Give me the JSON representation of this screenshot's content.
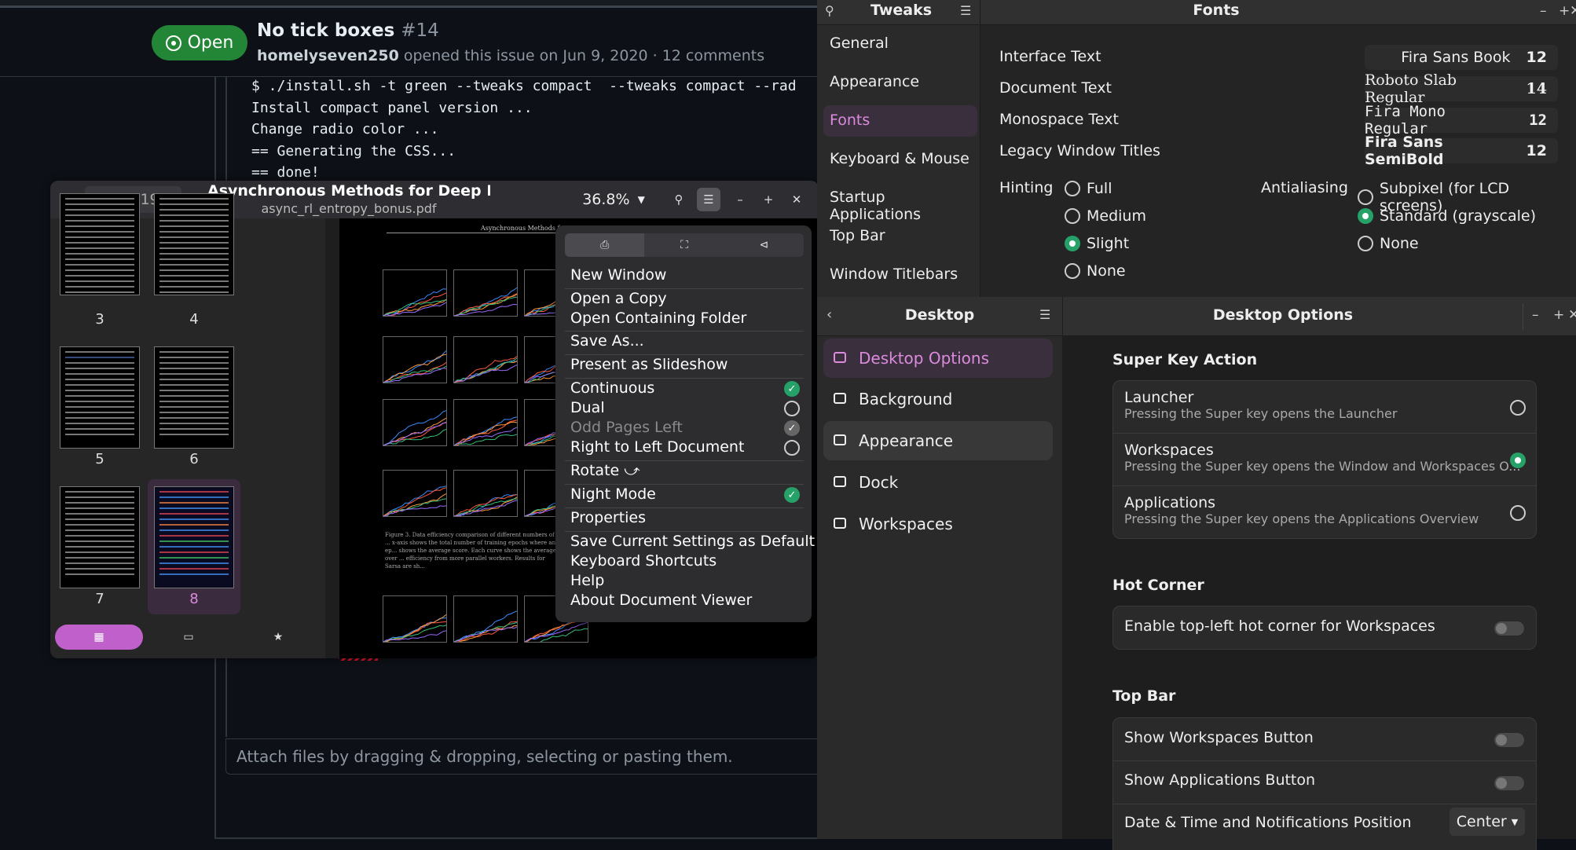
{
  "github": {
    "status_label": "Open",
    "issue_title": "No tick boxes",
    "issue_number": "#14",
    "author": "homelyseven250",
    "meta": "opened this issue on Jun 9, 2020 · 12 comments",
    "code_lines": [
      "$ ./install.sh -t green --tweaks compact  --tweaks compact --rad",
      "Install compact panel version ...",
      "Change radio color ...",
      "== Generating the CSS...",
      "== done!"
    ],
    "attach_placeholder": "Attach files by dragging & dropping, selecting or pasting them."
  },
  "viewer": {
    "current_page": "8",
    "page_total": "of 19",
    "title": "Asynchronous Methods for Deep Reinforcem...",
    "filename": "async_rl_entropy_bonus.pdf",
    "zoom": "36.8%",
    "thumbnails": [
      "3",
      "4",
      "5",
      "6",
      "7",
      "8"
    ],
    "pdf_header": "Asynchronous Methods f",
    "caption": "Figure 3. Data efficiency comparison of different numbers of ... x-axis shows the total number of training epochs where an ep... shows the average score. Each curve shows the average over ... efficiency from more parallel workers. Results for Sarsa are sh...",
    "menu": {
      "new_window": "New Window",
      "open_copy": "Open a Copy",
      "open_folder": "Open Containing Folder",
      "save_as": "Save As...",
      "present": "Present as Slideshow",
      "continuous": "Continuous",
      "dual": "Dual",
      "odd_left": "Odd Pages Left",
      "rtl": "Right to Left Document",
      "rotate": "Rotate",
      "night": "Night Mode",
      "properties": "Properties",
      "save_default": "Save Current Settings as Default",
      "shortcuts": "Keyboard Shortcuts",
      "help": "Help",
      "about": "About Document Viewer"
    }
  },
  "tweaks": {
    "app_title": "Tweaks",
    "page_title": "Fonts",
    "nav": [
      "General",
      "Appearance",
      "Fonts",
      "Keyboard & Mouse",
      "Startup Applications",
      "Top Bar",
      "Window Titlebars"
    ],
    "fonts": [
      {
        "label": "Interface Text",
        "font": "Fira Sans Book",
        "size": "12"
      },
      {
        "label": "Document Text",
        "font": "Roboto Slab Regular",
        "size": "14"
      },
      {
        "label": "Monospace Text",
        "font": "Fira Mono Regular",
        "size": "12"
      },
      {
        "label": "Legacy Window Titles",
        "font": "Fira Sans SemiBold",
        "size": "12"
      }
    ],
    "hinting_label": "Hinting",
    "hinting": [
      "Full",
      "Medium",
      "Slight",
      "None"
    ],
    "hinting_selected": "Slight",
    "antialias_label": "Antialiasing",
    "antialias": [
      "Subpixel (for LCD screens)",
      "Standard (grayscale)",
      "None"
    ],
    "antialias_selected": "Standard (grayscale)"
  },
  "desktop": {
    "app_title": "Desktop",
    "page_title": "Desktop Options",
    "nav": [
      "Desktop Options",
      "Background",
      "Appearance",
      "Dock",
      "Workspaces"
    ],
    "super_key_section": "Super Key Action",
    "super_options": [
      {
        "title": "Launcher",
        "sub": "Pressing the Super key opens the Launcher"
      },
      {
        "title": "Workspaces",
        "sub": "Pressing the Super key opens the Window and Workspaces O..."
      },
      {
        "title": "Applications",
        "sub": "Pressing the Super key opens the Applications Overview"
      }
    ],
    "super_selected": "Workspaces",
    "hot_corner_section": "Hot Corner",
    "hot_corner_label": "Enable top-left hot corner for Workspaces",
    "top_bar_section": "Top Bar",
    "show_workspaces": "Show Workspaces Button",
    "show_applications": "Show Applications Button",
    "datetime_label": "Date & Time and Notifications Position",
    "datetime_value": "Center"
  },
  "colors": {
    "accent": "#c061cb",
    "check": "#26a269",
    "github_green": "#238636"
  }
}
